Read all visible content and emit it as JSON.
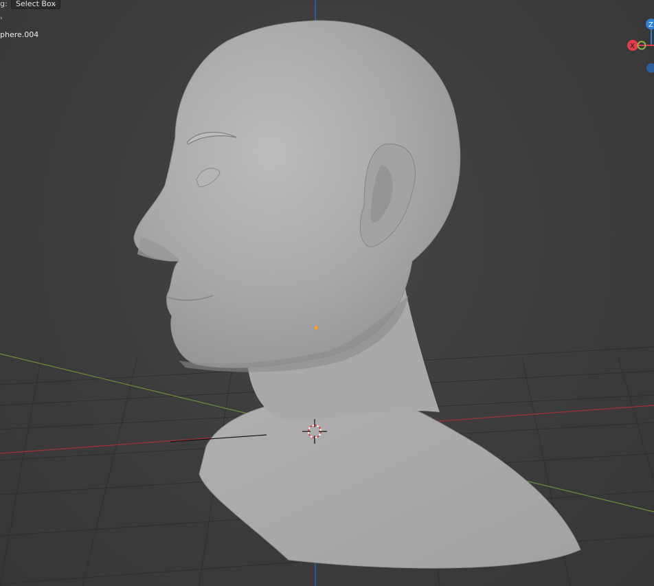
{
  "header": {
    "drag_label": "g:",
    "select_mode": "Select Box"
  },
  "overlay": {
    "object_name": "phere.004"
  },
  "gizmo": {
    "z_label": "Z",
    "x_label": "X"
  },
  "colors": {
    "axis_x": "#e23b4a",
    "axis_y": "#8ab84a",
    "axis_z": "#2f7fd6",
    "origin": "#ffa11b"
  }
}
